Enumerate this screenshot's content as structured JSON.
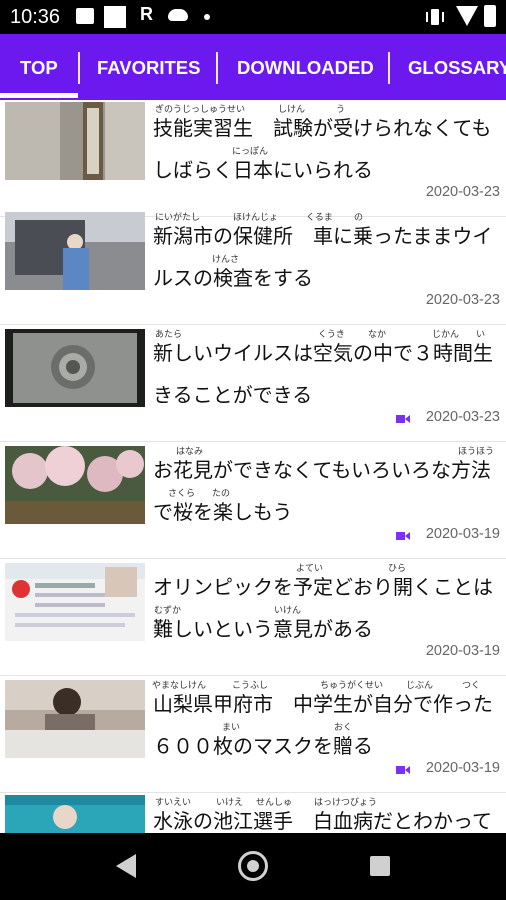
{
  "status_bar": {
    "time": "10:36",
    "r_label": "R"
  },
  "tabs": [
    {
      "label": "TOP"
    },
    {
      "label": "FAVORITES"
    },
    {
      "label": "DOWNLOADED"
    },
    {
      "label": "GLOSSARY"
    }
  ],
  "articles": [
    {
      "line1": "技能実習生　試験が受けられなくても",
      "line2": "しばらく日本にいられる",
      "ruby1": [
        "ぎのうじっしゅうせい",
        "しけん",
        "う"
      ],
      "ruby2": [
        "にっぽん"
      ],
      "date": "2020-03-23",
      "has_video": false
    },
    {
      "line1": "新潟市の保健所　車に乗ったままウイ",
      "line2": "ルスの検査をする",
      "ruby1": [
        "にいがたし",
        "ほけんじょ",
        "くるま",
        "の"
      ],
      "ruby2": [
        "けんさ"
      ],
      "date": "2020-03-23",
      "has_video": false
    },
    {
      "line1": "新しいウイルスは空気の中で３時間生",
      "line2": "きることができる",
      "ruby1": [
        "あたら",
        "くうき",
        "なか",
        "じかん",
        "い"
      ],
      "ruby2": [],
      "date": "2020-03-23",
      "has_video": true
    },
    {
      "line1": "お花見ができなくてもいろいろな方法",
      "line2": "で桜を楽しもう",
      "ruby1": [
        "はなみ",
        "ほうほう"
      ],
      "ruby2": [
        "さくら",
        "たの"
      ],
      "date": "2020-03-19",
      "has_video": true
    },
    {
      "line1": "オリンピックを予定どおり開くことは",
      "line2": "難しいという意見がある",
      "ruby1": [
        "よてい",
        "ひら"
      ],
      "ruby2": [
        "むずか",
        "いけん"
      ],
      "date": "2020-03-19",
      "has_video": false
    },
    {
      "line1": "山梨県甲府市　中学生が自分で作った",
      "line2": "６００枚のマスクを贈る",
      "ruby1": [
        "やまなしけん",
        "こうふし",
        "ちゅうがくせい",
        "じぶん",
        "つく"
      ],
      "ruby2": [
        "まい",
        "おく"
      ],
      "date": "2020-03-19",
      "has_video": true
    },
    {
      "line1": "水泳の池江選手　白血病だとわかって",
      "line2": "",
      "ruby1": [
        "すいえい",
        "いけえ",
        "せんしゅ",
        "はっけつびょう"
      ],
      "ruby2": [],
      "date": "",
      "has_video": false
    }
  ],
  "colors": {
    "accent": "#6c19f0",
    "video_icon": "#7b2ff7"
  }
}
